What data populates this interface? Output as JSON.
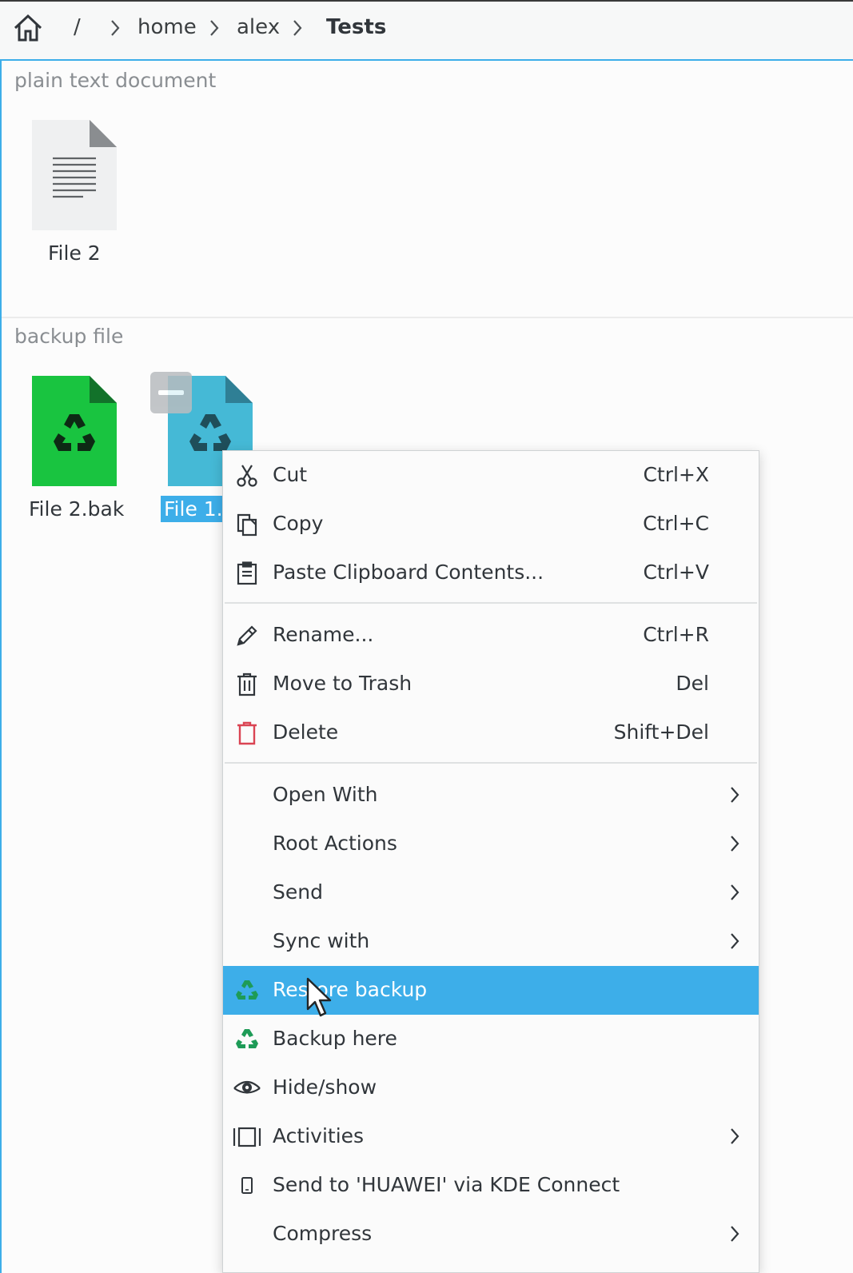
{
  "breadcrumb": {
    "home_icon": "home-icon",
    "items": [
      {
        "label": "/"
      },
      {
        "label": "home"
      },
      {
        "label": "alex"
      },
      {
        "label": "Tests"
      }
    ]
  },
  "view": {
    "groups": [
      {
        "title": "plain text document",
        "files": [
          {
            "name": "File 2",
            "icon": "text-document-icon"
          }
        ]
      },
      {
        "title": "backup file",
        "files": [
          {
            "name": "File 2.bak",
            "icon": "backup-file-icon",
            "color": "#19c440"
          },
          {
            "name": "File 1.",
            "icon": "backup-file-icon",
            "color": "#45b9d6",
            "selected": true
          }
        ]
      }
    ]
  },
  "context_menu": {
    "items": [
      {
        "label": "Cut",
        "shortcut": "Ctrl+X",
        "icon": "cut-icon"
      },
      {
        "label": "Copy",
        "shortcut": "Ctrl+C",
        "icon": "copy-icon"
      },
      {
        "label": "Paste Clipboard Contents...",
        "shortcut": "Ctrl+V",
        "icon": "paste-icon"
      },
      {
        "label": "Rename...",
        "shortcut": "Ctrl+R",
        "icon": "rename-icon"
      },
      {
        "label": "Move to Trash",
        "shortcut": "Del",
        "icon": "trash-icon"
      },
      {
        "label": "Delete",
        "shortcut": "Shift+Del",
        "icon": "delete-icon"
      },
      {
        "label": "Open With",
        "submenu": true
      },
      {
        "label": "Root Actions",
        "submenu": true
      },
      {
        "label": "Send",
        "submenu": true
      },
      {
        "label": "Sync with",
        "submenu": true
      },
      {
        "label": "Restore backup",
        "icon": "recycle-icon",
        "highlighted": true
      },
      {
        "label": "Backup here",
        "icon": "recycle-icon"
      },
      {
        "label": "Hide/show",
        "icon": "eye-icon"
      },
      {
        "label": "Activities",
        "icon": "activities-icon",
        "submenu": true
      },
      {
        "label": "Send to 'HUAWEI' via KDE Connect",
        "icon": "phone-icon"
      },
      {
        "label": "Compress",
        "submenu": true
      }
    ]
  },
  "colors": {
    "accent": "#3daee9",
    "delete_icon": "#da4453",
    "recycle_icon": "#1e9b57"
  }
}
